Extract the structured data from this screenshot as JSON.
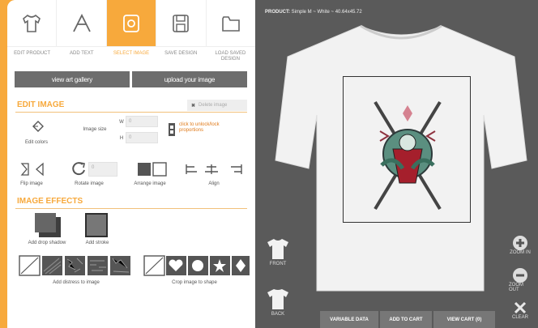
{
  "tools": [
    {
      "name": "edit-product",
      "label": "EDIT PRODUCT"
    },
    {
      "name": "add-text",
      "label": "ADD TEXT"
    },
    {
      "name": "select-image",
      "label": "SELECT IMAGE"
    },
    {
      "name": "save-design",
      "label": "SAVE DESIGN"
    },
    {
      "name": "load-saved-design",
      "label": "LOAD SAVED DESIGN"
    }
  ],
  "gallery_buttons": {
    "view": "view art gallery",
    "upload": "upload your image"
  },
  "edit_image": {
    "title": "EDIT IMAGE",
    "delete_label": "Delete image",
    "edit_colors": "Edit colors",
    "image_size": "Image size",
    "w_label": "W",
    "h_label": "H",
    "w_value": "0",
    "h_value": "0",
    "lock_text": "click to unlock/lock proportions",
    "flip": "Flip image",
    "rotate": "Rotate image",
    "rotate_value": "0",
    "arrange": "Arrange image",
    "align": "Align"
  },
  "effects": {
    "title": "IMAGE EFFECTS",
    "drop_shadow": "Add drop shadow",
    "stroke": "Add stroke",
    "distress": "Add distress to image",
    "crop": "Crop image to shape"
  },
  "preview": {
    "product_label": "PRODUCT:",
    "product_value": "Simple M ~ White ~ 40.64x45.72",
    "front": "FRONT",
    "back": "BACK",
    "variable_data": "VARIABLE DATA",
    "add_to_cart": "ADD TO CART",
    "view_cart": "VIEW CART (0)",
    "zoom_in": "ZOOM IN",
    "zoom_out": "ZOOM OUT",
    "clear": "CLEAR"
  },
  "colors": {
    "accent": "#f7a93c",
    "gray": "#6d6d6d",
    "canvas": "#5a5a5a"
  }
}
